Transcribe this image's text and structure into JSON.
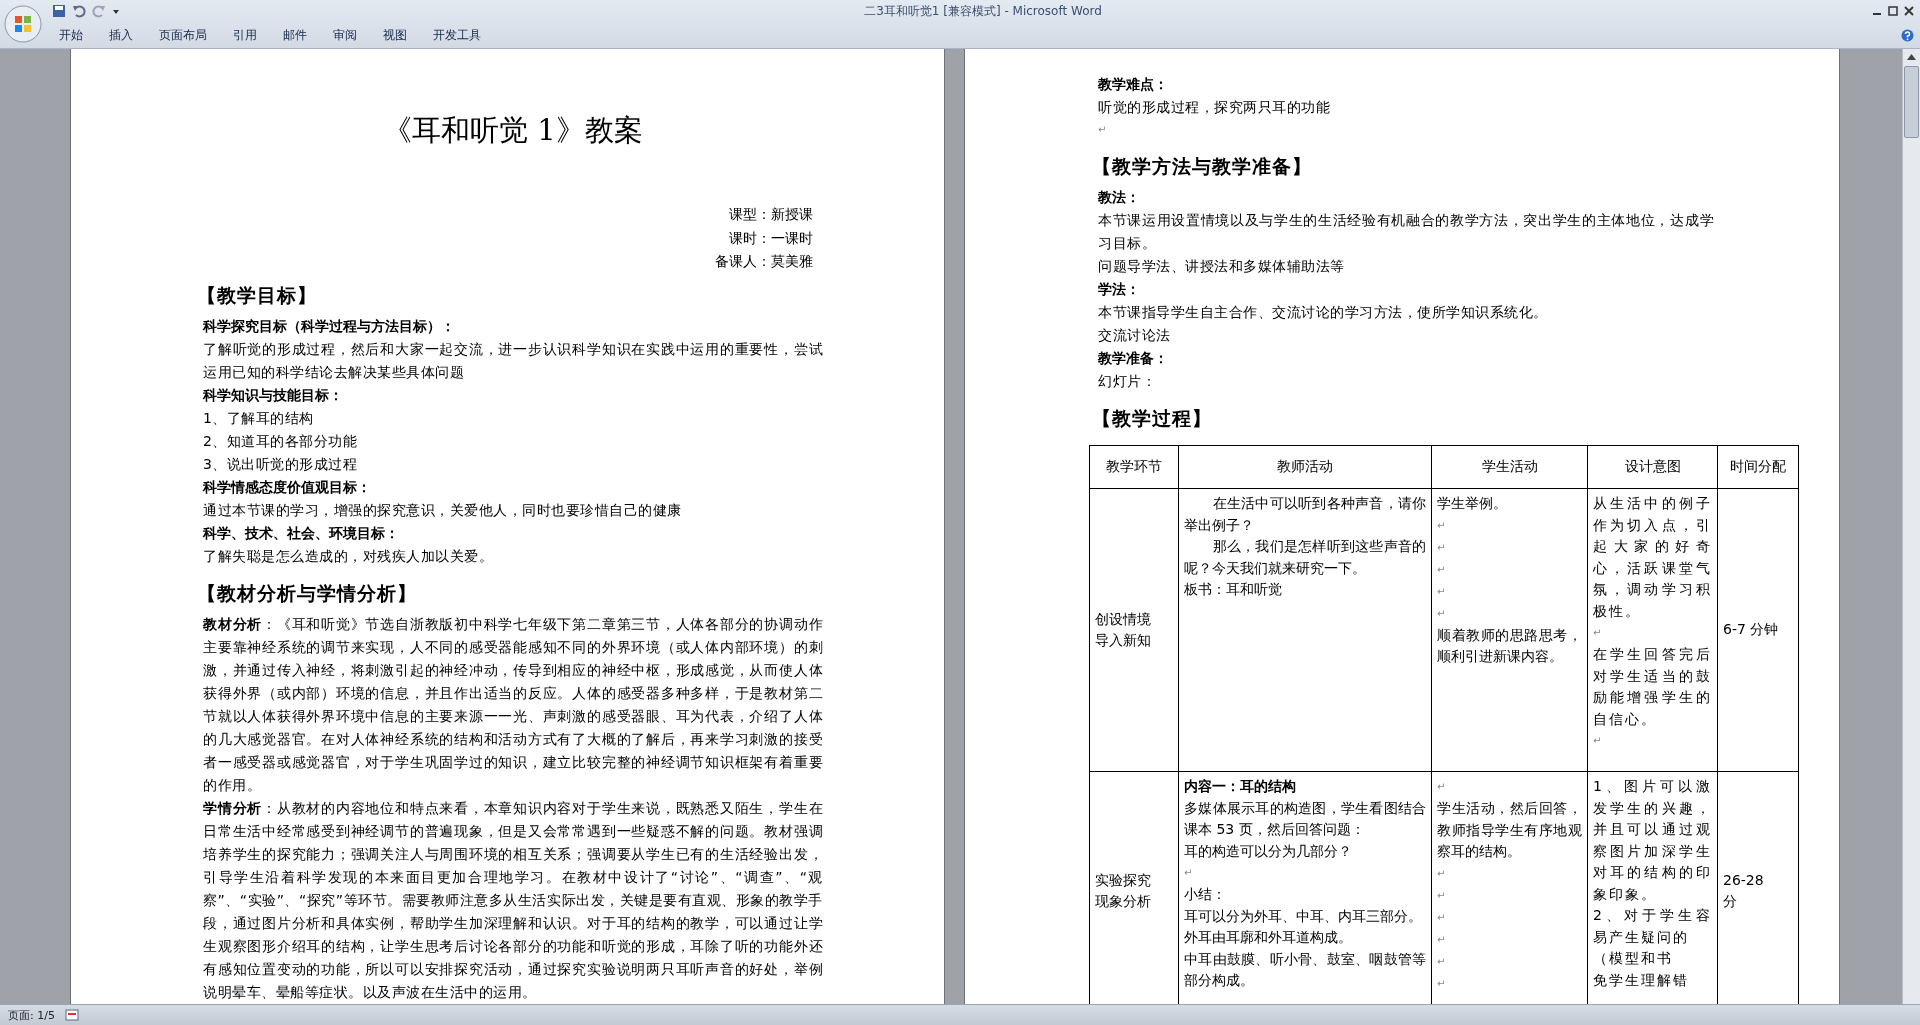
{
  "window": {
    "title": "二3耳和听觉1 [兼容模式] - Microsoft Word"
  },
  "ribbon": {
    "tabs": [
      "开始",
      "插入",
      "页面布局",
      "引用",
      "邮件",
      "审阅",
      "视图",
      "开发工具"
    ]
  },
  "left_page": {
    "blocks": [
      {
        "kind": "title",
        "text": "《耳和听觉 1》教案"
      },
      {
        "kind": "meta",
        "text": "课型：新授课"
      },
      {
        "kind": "meta",
        "text": "课时：一课时"
      },
      {
        "kind": "meta",
        "text": "备课人：莫美雅"
      },
      {
        "kind": "heading",
        "text": "【教学目标】"
      },
      {
        "kind": "label",
        "text": "科学探究目标（科学过程与方法目标）："
      },
      {
        "kind": "text",
        "text": "了解听觉的形成过程，然后和大家一起交流，进一步认识科学知识在实践中运用的重要性，尝试运用已知的科学结论去解决某些具体问题"
      },
      {
        "kind": "label",
        "text": "科学知识与技能目标："
      },
      {
        "kind": "text",
        "text": "1、了解耳的结构"
      },
      {
        "kind": "text",
        "text": "2、知道耳的各部分功能"
      },
      {
        "kind": "text",
        "text": "3、说出听觉的形成过程"
      },
      {
        "kind": "label",
        "text": "科学情感态度价值观目标："
      },
      {
        "kind": "text",
        "text": "通过本节课的学习，增强的探究意识，关爱他人，同时也要珍惜自己的健康"
      },
      {
        "kind": "label",
        "text": "科学、技术、社会、环境目标："
      },
      {
        "kind": "text",
        "text": "了解失聪是怎么造成的，对残疾人加以关爱。"
      },
      {
        "kind": "heading",
        "text": "【教材分析与学情分析】"
      },
      {
        "kind": "text",
        "text": "**教材分析**：《耳和听觉》节选自浙教版初中科学七年级下第二章第三节，人体各部分的协调动作主要靠神经系统的调节来实现，人不同的感受器能感知不同的外界环境（或人体内部环境）的刺激，并通过传入神经，将刺激引起的神经冲动，传导到相应的神经中枢，形成感觉，从而使人体获得外界（或内部）环境的信息，并且作出适当的反应。人体的感受器多种多样，于是教材第二节就以人体获得外界环境中信息的主要来源一一光、声刺激的感受器眼、耳为代表，介绍了人体的几大感觉器官。在对人体神经系统的结构和活动方式有了大概的了解后，再来学习刺激的接受者一感受器或感觉器官，对于学生巩固学过的知识，建立比较完整的神经调节知识框架有着重要的作用。"
      },
      {
        "kind": "text",
        "text": "**学情分析**：从教材的内容地位和特点来看，本章知识内容对于学生来说，既熟悉又陌生，学生在日常生活中经常感受到神经调节的普遍现象，但是又会常常遇到一些疑惑不解的问题。教材强调培养学生的探究能力；强调关注人与周围环境的相互关系；强调要从学生已有的生活经验出发，引导学生沿着科学发现的本来面目更加合理地学习。在教材中设计了“讨论”、“调查”、“观察”、“实验”、“探究”等环节。需要教师注意多从生活实际出发，关键是要有直观、形象的教学手段，通过图片分析和具体实例，帮助学生加深理解和认识。对于耳的结构的教学，可以通过让学生观察图形介绍耳的结构，让学生思考后讨论各部分的功能和听觉的形成，耳除了听的功能外还有感知位置变动的功能，所以可以安排探究活动，通过探究实验说明两只耳听声音的好处，举例说明晕车、晕船等症状。以及声波在生活中的运用。"
      }
    ]
  },
  "right_page": {
    "blocks": [
      {
        "kind": "label",
        "text": "教学难点："
      },
      {
        "kind": "text",
        "text": "听觉的形成过程，探究两只耳的功能"
      },
      {
        "kind": "mark",
        "text": "↵"
      },
      {
        "kind": "heading",
        "text": "【教学方法与教学准备】"
      },
      {
        "kind": "label",
        "text": "教法："
      },
      {
        "kind": "text",
        "text": "本节课运用设置情境以及与学生的生活经验有机融合的教学方法，突出学生的主体地位，达成学习目标。"
      },
      {
        "kind": "text",
        "text": "问题导学法、讲授法和多媒体辅助法等"
      },
      {
        "kind": "label",
        "text": "学法："
      },
      {
        "kind": "text",
        "text": "本节课指导学生自主合作、交流讨论的学习方法，使所学知识系统化。"
      },
      {
        "kind": "text",
        "text": "交流讨论法"
      },
      {
        "kind": "label",
        "text": "教学准备："
      },
      {
        "kind": "text",
        "text": "幻灯片："
      },
      {
        "kind": "heading",
        "text": "【教学过程】"
      }
    ],
    "table": {
      "columns": [
        "教学环节",
        "教师活动",
        "学生活动",
        "设计意图",
        "时间分配"
      ],
      "rows": [
        {
          "cells": [
            [
              "创设情境",
              "导入新知"
            ],
            [
              "　　在生活中可以听到各种声音，请你举出例子？",
              "　　那么，我们是怎样听到这些声音的呢？今天我们就来研究一下。",
              "板书：耳和听觉"
            ],
            [
              "学生举例。",
              "↵",
              "↵",
              "↵",
              "↵",
              "↵",
              "顺着教师的思路思考，顺利引进新课内容。"
            ],
            [
              "从生活中的例子作为切入点，引起大家的好奇心，活跃课堂气氛，调动学习积极性。",
              "↵",
              "在学生回答完后对学生适当的鼓励能增强学生的自信心。",
              "↵"
            ],
            [
              "6-7 分钟"
            ]
          ]
        },
        {
          "cells": [
            [
              "实验探究",
              "现象分析"
            ],
            [
              "**内容一：耳的结构**",
              "多媒体展示耳的构造图，学生看图结合课本 53 页，然后回答问题：",
              "耳的构造可以分为几部分？",
              "↵",
              "小结：",
              "耳可以分为外耳、中耳、内耳三部分。",
              "外耳由耳廓和外耳道构成。",
              "中耳由鼓膜、听小骨、鼓室、咽鼓管等部分构成。"
            ],
            [
              "↵",
              "学生活动，然后回答，教师指导学生有序地观察耳的结构。",
              "↵",
              "↵",
              "↵",
              "↵",
              "↵",
              "↵"
            ],
            [
              "1、图片可以激发学生的兴趣，并且可以通过观察图片加深学生对耳的结构的印象印象。",
              "2、对于学生容易产生疑问的",
              "（模型和书",
              "免学生理解错"
            ],
            [
              "26-28",
              "分"
            ]
          ]
        }
      ]
    }
  },
  "status_bar": {
    "page": "页面: 1/5"
  }
}
